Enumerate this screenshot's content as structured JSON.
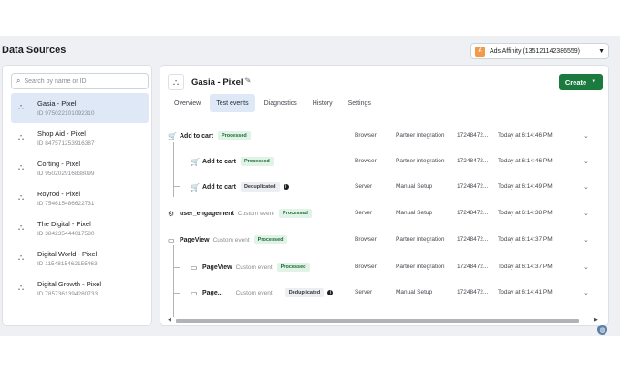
{
  "header": {
    "title": "Data Sources"
  },
  "account": {
    "avatar": "A",
    "name": "Ads Affinity (135121142386559)",
    "chevron": "▼"
  },
  "search": {
    "placeholder": "Search by name or ID",
    "icon": "⌕"
  },
  "sources": [
    {
      "name": "Gasia - Pixel",
      "id": "ID 975022101092310",
      "active": true
    },
    {
      "name": "Shop Aid - Pixel",
      "id": "ID 847571253916387"
    },
    {
      "name": "Corting - Pixel",
      "id": "ID 950202916838099"
    },
    {
      "name": "Royrod - Pixel",
      "id": "ID 754615486622731"
    },
    {
      "name": "The Digital - Pixel",
      "id": "ID 384235444017580"
    },
    {
      "name": "Digital World - Pixel",
      "id": "ID 1154815462155463"
    },
    {
      "name": "Digital Growth - Pixel",
      "id": "ID 7857361394280733"
    }
  ],
  "pixel": {
    "name": "Gasia - Pixel",
    "edit_icon": "✎",
    "icon": "⛬"
  },
  "create_button": {
    "label": "Create",
    "chevron": "▼"
  },
  "tabs": [
    {
      "label": "Overview"
    },
    {
      "label": "Test events",
      "active": true
    },
    {
      "label": "Diagnostics"
    },
    {
      "label": "History"
    },
    {
      "label": "Settings"
    }
  ],
  "events": [
    {
      "name": "Add to cart",
      "custom": "",
      "status": "Processed",
      "source": "Browser",
      "integration": "Partner integration",
      "id": "17248472...",
      "time": "Today at 6:14:46 PM"
    },
    {
      "name": "Add to cart",
      "custom": "",
      "status": "Processed",
      "source": "Browser",
      "integration": "Partner integration",
      "id": "17248472...",
      "time": "Today at 6:14:46 PM"
    },
    {
      "name": "Add to cart",
      "custom": "",
      "status": "Deduplicated",
      "source": "Server",
      "integration": "Manual Setup",
      "id": "17248472...",
      "time": "Today at 6:14:49 PM"
    },
    {
      "name": "user_engagement",
      "custom": "Custom event",
      "status": "Processed",
      "source": "Server",
      "integration": "Manual Setup",
      "id": "17248472...",
      "time": "Today at 6:14:38 PM"
    },
    {
      "name": "PageView",
      "custom": "Custom event",
      "status": "Processed",
      "source": "Browser",
      "integration": "Partner integration",
      "id": "17248472...",
      "time": "Today at 6:14:37 PM"
    },
    {
      "name": "PageView",
      "custom": "Custom event",
      "status": "Processed",
      "source": "Browser",
      "integration": "Partner integration",
      "id": "17248472...",
      "time": "Today at 6:14:37 PM"
    },
    {
      "name": "Page...",
      "custom": "Custom event",
      "status": "Deduplicated",
      "source": "Server",
      "integration": "Manual Setup",
      "id": "17248472...",
      "time": "Today at 6:14:41 PM"
    }
  ],
  "icons": {
    "cart": "🛒",
    "engagement": "⚙",
    "page": "▭",
    "row_chevron": "⌄",
    "info": "i",
    "globe": "◍",
    "source": "⛬"
  },
  "colors": {
    "create_button": "#1b7b3e",
    "active_tab": "#dfe8f7",
    "processed_badge": "#e1f3e6"
  }
}
